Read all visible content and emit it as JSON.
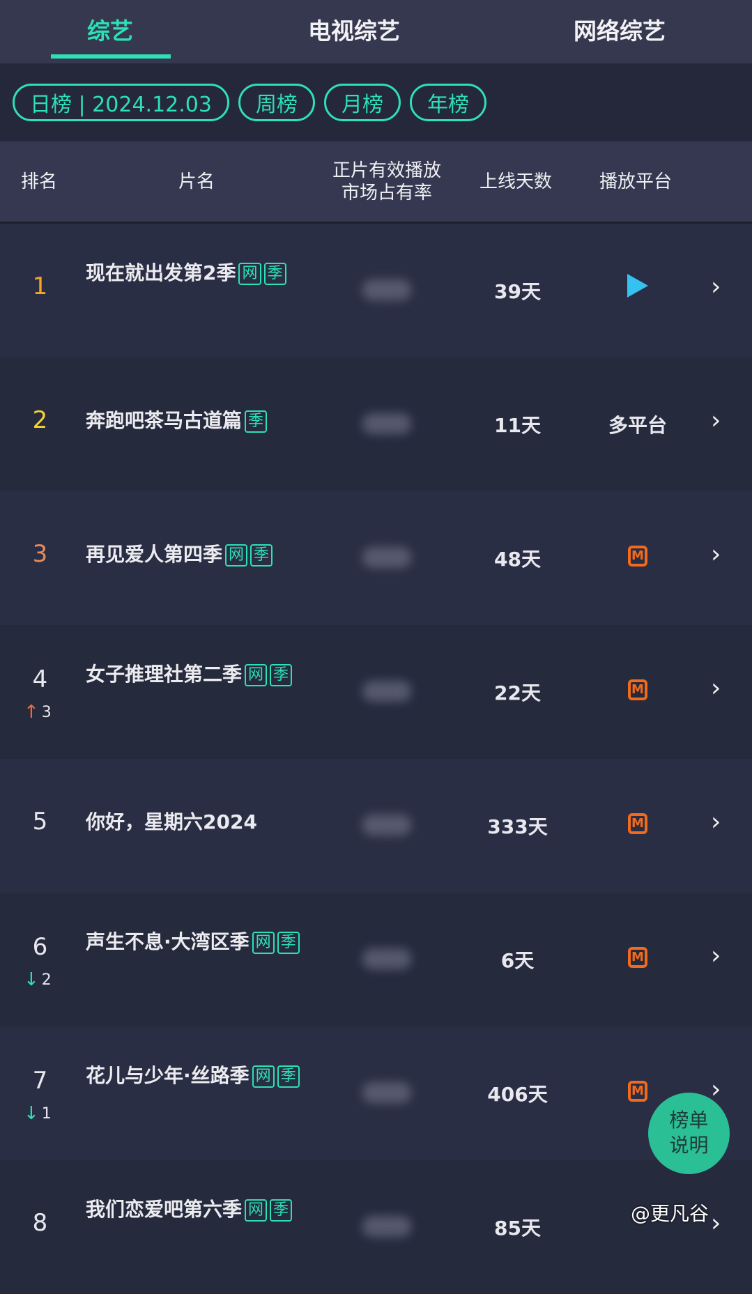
{
  "tabs": [
    {
      "label": "综艺",
      "active": true
    },
    {
      "label": "电视综艺"
    },
    {
      "label": "网络综艺"
    }
  ],
  "filters": [
    "日榜 | 2024.12.03",
    "周榜",
    "月榜",
    "年榜"
  ],
  "columns": {
    "rank": "排名",
    "name": "片名",
    "share_line1": "正片有效播放",
    "share_line2": "市场占有率",
    "days": "上线天数",
    "platform": "播放平台"
  },
  "accent": "#2de0b5",
  "rows": [
    {
      "rank": "1",
      "name": "现在就出发第2季",
      "tags": [
        "网",
        "季"
      ],
      "days": "39天",
      "platform_icon": "tencent-video-icon",
      "platform": ""
    },
    {
      "rank": "2",
      "name": "奔跑吧茶马古道篇",
      "tags": [
        "季"
      ],
      "days": "11天",
      "platform": "多平台"
    },
    {
      "rank": "3",
      "name": "再见爱人第四季",
      "tags": [
        "网",
        "季"
      ],
      "days": "48天",
      "platform_icon": "mango-tv-icon",
      "platform": ""
    },
    {
      "rank": "4",
      "trend": "up",
      "change": "3",
      "name": "女子推理社第二季",
      "tags": [
        "网",
        "季"
      ],
      "days": "22天",
      "platform_icon": "mango-tv-icon",
      "platform": ""
    },
    {
      "rank": "5",
      "name": "你好，星期六2024",
      "tags": [],
      "days": "333天",
      "platform_icon": "mango-tv-icon",
      "platform": ""
    },
    {
      "rank": "6",
      "trend": "down",
      "change": "2",
      "name": "声生不息·大湾区季",
      "tags": [
        "网",
        "季"
      ],
      "days": "6天",
      "platform_icon": "mango-tv-icon",
      "platform": ""
    },
    {
      "rank": "7",
      "trend": "down",
      "change": "1",
      "name": "花儿与少年·丝路季",
      "tags": [
        "网",
        "季"
      ],
      "days": "406天",
      "platform_icon": "mango-tv-icon",
      "platform": ""
    },
    {
      "rank": "8",
      "name": "我们恋爱吧第六季",
      "tags": [
        "网",
        "季"
      ],
      "days": "85天",
      "platform": ""
    }
  ],
  "fab": {
    "line1": "榜单",
    "line2": "说明"
  },
  "watermark": "@更凡谷"
}
